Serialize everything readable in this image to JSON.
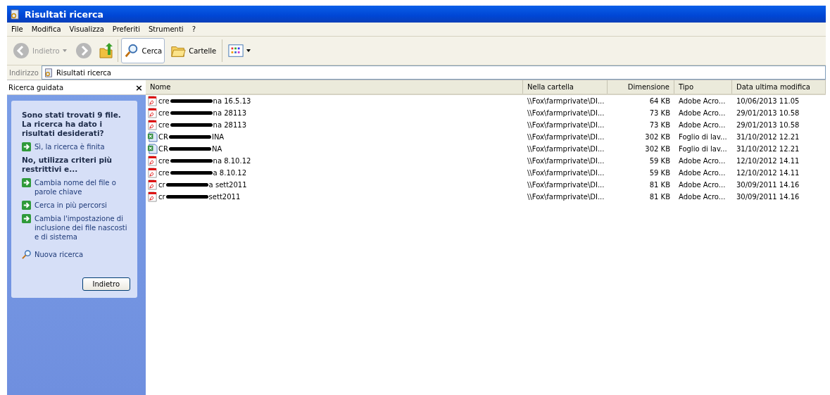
{
  "window": {
    "title": "Risultati ricerca"
  },
  "menu": [
    "File",
    "Modifica",
    "Visualizza",
    "Preferiti",
    "Strumenti",
    "?"
  ],
  "toolbar": {
    "back": {
      "label": "Indietro",
      "disabled": true
    },
    "forward": {
      "disabled": true
    },
    "search": {
      "label": "Cerca",
      "selected": true
    },
    "folders": {
      "label": "Cartelle",
      "selected": false
    }
  },
  "address": {
    "label": "Indirizzo",
    "value": "Risultati ricerca"
  },
  "sidebar": {
    "title": "Ricerca guidata",
    "close": "×",
    "heading": "Sono stati trovati 9 file. La ricerca ha dato i risultati desiderati?",
    "yes_link": "Sì, la ricerca è finita",
    "subheading": "No, utilizza criteri più restrittivi e...",
    "links": [
      {
        "kind": "arrow",
        "label": "Cambia nome del file o parole chiave"
      },
      {
        "kind": "arrow",
        "label": "Cerca in più percorsi"
      },
      {
        "kind": "arrow",
        "label": "Cambia l'impostazione di inclusione dei file nascosti e di sistema"
      },
      {
        "kind": "search",
        "label": "Nuova ricerca"
      }
    ],
    "button": "Indietro"
  },
  "table": {
    "columns": [
      "Nome",
      "Nella cartella",
      "Dimensione",
      "Tipo",
      "Data ultima modifica"
    ],
    "rows": [
      {
        "kind": "pdf",
        "name_start": "cre",
        "name_end": "na 16.5.13",
        "folder": "\\\\Fox\\farmprivate\\DI...",
        "size": "64 KB",
        "type": "Adobe Acro...",
        "modified": "10/06/2013 11.05"
      },
      {
        "kind": "pdf",
        "name_start": "cre",
        "name_end": "na 28113",
        "folder": "\\\\Fox\\farmprivate\\DI...",
        "size": "73 KB",
        "type": "Adobe Acro...",
        "modified": "29/01/2013 10.58"
      },
      {
        "kind": "pdf",
        "name_start": "cre",
        "name_end": "na 28113",
        "folder": "\\\\Fox\\farmprivate\\DI...",
        "size": "73 KB",
        "type": "Adobe Acro...",
        "modified": "29/01/2013 10.58"
      },
      {
        "kind": "excel",
        "name_start": "CR",
        "name_end": "INA",
        "folder": "\\\\Fox\\farmprivate\\DI...",
        "size": "302 KB",
        "type": "Foglio di lav...",
        "modified": "31/10/2012 12.21"
      },
      {
        "kind": "excel",
        "name_start": "CR",
        "name_end": "NA",
        "folder": "\\\\Fox\\farmprivate\\DI...",
        "size": "302 KB",
        "type": "Foglio di lav...",
        "modified": "31/10/2012 12.21"
      },
      {
        "kind": "pdf",
        "name_start": "cre",
        "name_end": "na 8.10.12",
        "folder": "\\\\Fox\\farmprivate\\DI...",
        "size": "59 KB",
        "type": "Adobe Acro...",
        "modified": "12/10/2012 14.11"
      },
      {
        "kind": "pdf",
        "name_start": "cre",
        "name_end": "a 8.10.12",
        "folder": "\\\\Fox\\farmprivate\\DI...",
        "size": "59 KB",
        "type": "Adobe Acro...",
        "modified": "12/10/2012 14.11"
      },
      {
        "kind": "pdf",
        "name_start": "cr",
        "name_end": "a sett2011",
        "folder": "\\\\Fox\\farmprivate\\DI...",
        "size": "81 KB",
        "type": "Adobe Acro...",
        "modified": "30/09/2011 14.16"
      },
      {
        "kind": "pdf",
        "name_start": "cr",
        "name_end": "sett2011",
        "folder": "\\\\Fox\\farmprivate\\DI...",
        "size": "81 KB",
        "type": "Adobe Acro...",
        "modified": "30/09/2011 14.16"
      }
    ]
  }
}
